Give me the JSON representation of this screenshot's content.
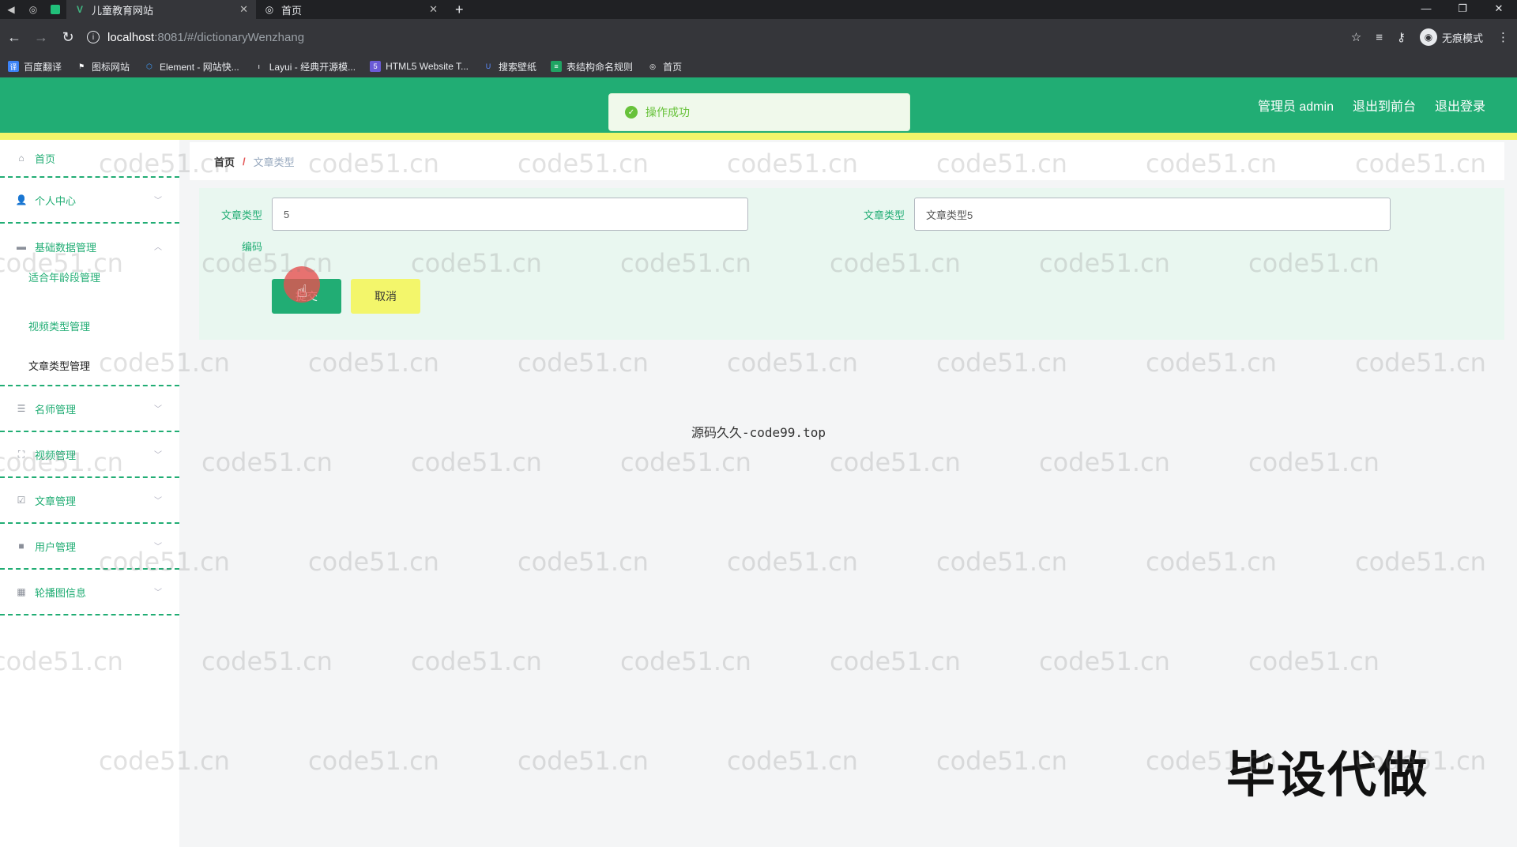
{
  "browser": {
    "tabs": [
      {
        "title": "儿童教育网站",
        "active": true
      },
      {
        "title": "首页",
        "active": false
      }
    ],
    "url_host": "localhost",
    "url_path": ":8081/#/dictionaryWenzhang",
    "incognito_label": "无痕模式",
    "bookmarks": [
      "百度翻译",
      "图标网站",
      "Element - 网站快...",
      "Layui - 经典开源模...",
      "HTML5 Website T...",
      "搜索壁纸",
      "表结构命名规则",
      "首页"
    ]
  },
  "header": {
    "admin_label": "管理员 admin",
    "front_link": "退出到前台",
    "logout_link": "退出登录"
  },
  "toast": {
    "message": "操作成功"
  },
  "sidebar": {
    "home": "首页",
    "personal": "个人中心",
    "basic": "基础数据管理",
    "basic_subs": [
      "适合年龄段管理",
      "视频类型管理",
      "文章类型管理"
    ],
    "teacher": "名师管理",
    "video": "视频管理",
    "article": "文章管理",
    "user": "用户管理",
    "carousel": "轮播图信息"
  },
  "breadcrumb": {
    "home": "首页",
    "separator": "/",
    "current": "文章类型"
  },
  "form": {
    "code_label_line1": "文章类型",
    "code_label_line2": "编码",
    "code_value": "5",
    "type_label": "文章类型",
    "type_value": "文章类型5",
    "submit_label": "提交",
    "cancel_label": "取消"
  },
  "center_text": "源码久久-code99.top",
  "overlay_text": "毕设代做",
  "watermark": "code51.cn"
}
